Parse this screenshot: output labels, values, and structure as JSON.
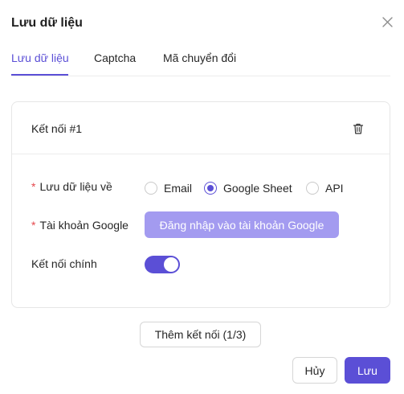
{
  "dialog": {
    "title": "Lưu dữ liệu",
    "close_icon": "close-icon"
  },
  "tabs": [
    {
      "label": "Lưu dữ liệu",
      "active": true
    },
    {
      "label": "Captcha",
      "active": false
    },
    {
      "label": "Mã chuyển đổi",
      "active": false
    }
  ],
  "connection": {
    "title": "Kết nối #1",
    "delete_icon": "trash-icon",
    "save_to": {
      "label": "Lưu dữ liệu về",
      "required": true,
      "options": [
        "Email",
        "Google Sheet",
        "API"
      ],
      "selected": "Google Sheet"
    },
    "google_account": {
      "label": "Tài khoản Google",
      "required": true,
      "button_label": "Đăng nhập vào tài khoản Google"
    },
    "primary": {
      "label": "Kết nối chính",
      "enabled": true
    }
  },
  "add_connection_label": "Thêm kết nối (1/3)",
  "footer": {
    "cancel_label": "Hủy",
    "save_label": "Lưu"
  },
  "colors": {
    "accent": "#5b4fd6",
    "accent_disabled": "#a39bf0",
    "required": "#e5484d"
  }
}
